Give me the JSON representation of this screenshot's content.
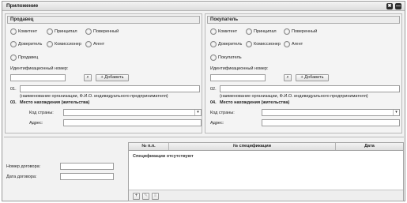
{
  "window": {
    "title": "Приложение",
    "close_icon": "✖",
    "minimize_icon": "—"
  },
  "seller": {
    "title": "Продавец",
    "roles": [
      "Комитент",
      "Принципал",
      "Поверенный",
      "Доверитель",
      "Комиссионер",
      "Агент",
      "Продавец"
    ],
    "id_label": "Идентификационный номер:",
    "id_value": "",
    "search_icon": "⌕",
    "add_label": "Добавить",
    "add_icon": "+",
    "name_number": "01.",
    "name_hint": "(наименование организации, Ф.И.О. индивидуального предпринимателя)",
    "location_number": "03.",
    "location_label": "Место нахождения (жительства)",
    "country_label": "Код страны:",
    "country_value": "",
    "address_label": "Адрес:",
    "address_value": ""
  },
  "buyer": {
    "title": "Покупатель",
    "roles": [
      "Комитент",
      "Принципал",
      "Поверенный",
      "Доверитель",
      "Комиссионер",
      "Агент",
      "Покупатель"
    ],
    "id_label": "Идентификационный номер:",
    "id_value": "",
    "search_icon": "⌕",
    "add_label": "Добавить",
    "add_icon": "+",
    "name_number": "02.",
    "name_hint": "(наименование организации, Ф.И.О. индивидуального предпринимателя)",
    "location_number": "04.",
    "location_label": "Место нахождения (жительства)",
    "country_label": "Код страны:",
    "country_value": "",
    "address_label": "Адрес:",
    "address_value": ""
  },
  "contract": {
    "number_label": "Номер договора:",
    "number_value": "",
    "date_label": "Дата договора:",
    "date_value": ""
  },
  "spec_table": {
    "columns": [
      "№ п.п.",
      "№ спецификации",
      "Дата"
    ],
    "empty_text": "Спецификации отсутствуют",
    "add_icon": "+",
    "edit_icon": "✎",
    "delete_icon": "≡"
  },
  "icons": {
    "dropdown_arrow": "▾"
  }
}
